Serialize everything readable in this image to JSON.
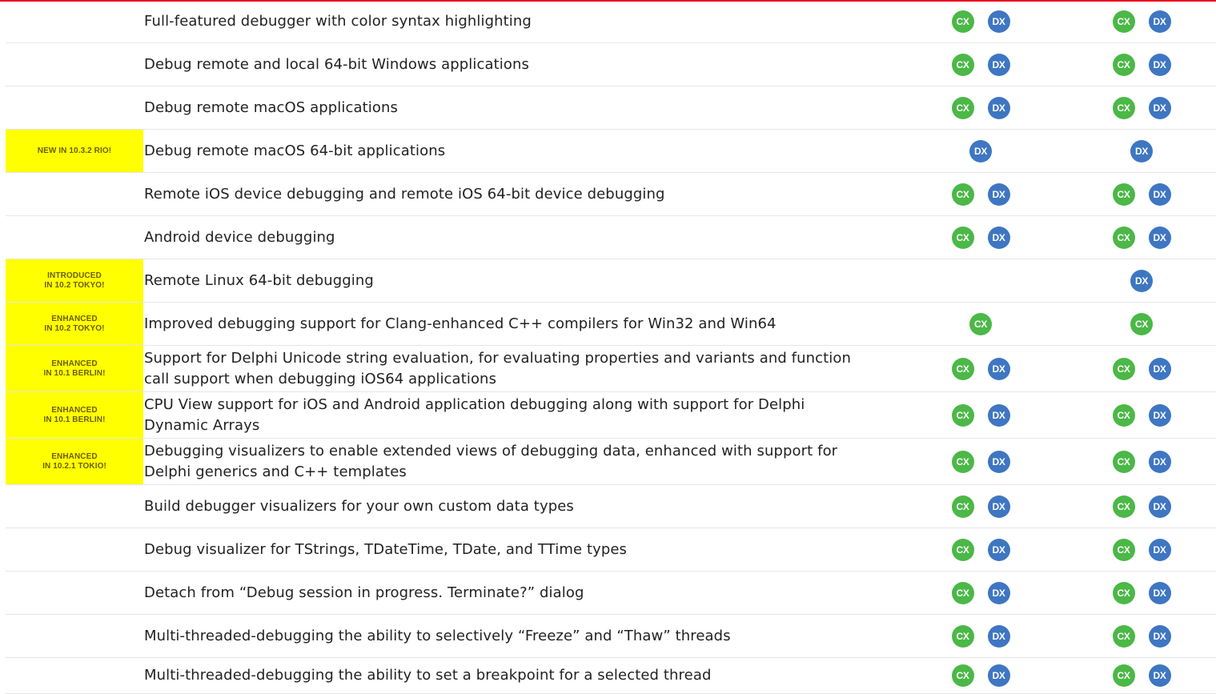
{
  "colors": {
    "cx": "#4bb847",
    "dx": "#3e76c2",
    "badge_bg": "#ffff00",
    "top_rule": "#e8001c"
  },
  "editions": {
    "cx": "CX",
    "dx": "DX"
  },
  "rows": [
    {
      "feature": "Full-featured debugger with color syntax highlighting",
      "badge": [],
      "col1": [
        "cx",
        "dx"
      ],
      "col2": [
        "cx",
        "dx"
      ]
    },
    {
      "feature": "Debug remote and local 64-bit Windows applications",
      "badge": [],
      "col1": [
        "cx",
        "dx"
      ],
      "col2": [
        "cx",
        "dx"
      ]
    },
    {
      "feature": "Debug remote macOS applications",
      "badge": [],
      "col1": [
        "cx",
        "dx"
      ],
      "col2": [
        "cx",
        "dx"
      ]
    },
    {
      "feature": "Debug remote macOS 64-bit applications",
      "badge": [
        "NEW IN 10.3.2 RIO!"
      ],
      "col1": [
        "dx"
      ],
      "col2": [
        "dx"
      ]
    },
    {
      "feature": "Remote iOS device debugging and remote iOS 64-bit device debugging",
      "badge": [],
      "col1": [
        "cx",
        "dx"
      ],
      "col2": [
        "cx",
        "dx"
      ]
    },
    {
      "feature": "Android device debugging",
      "badge": [],
      "col1": [
        "cx",
        "dx"
      ],
      "col2": [
        "cx",
        "dx"
      ]
    },
    {
      "feature": "Remote Linux 64-bit debugging",
      "badge": [
        "INTRODUCED",
        "IN 10.2 TOKYO!"
      ],
      "col1": [],
      "col2": [
        "dx"
      ]
    },
    {
      "feature": "Improved debugging support for Clang-enhanced C++ compilers for Win32 and Win64",
      "badge": [
        "ENHANCED",
        "IN 10.2 TOKYO!"
      ],
      "col1": [
        "cx"
      ],
      "col2": [
        "cx"
      ]
    },
    {
      "feature": "Support for Delphi Unicode string evaluation, for evaluating properties and variants and function call support when debugging iOS64 applications",
      "badge": [
        "ENHANCED",
        "IN 10.1 BERLIN!"
      ],
      "col1": [
        "cx",
        "dx"
      ],
      "col2": [
        "cx",
        "dx"
      ]
    },
    {
      "feature": "CPU View support for iOS and Android application debugging along with support for Delphi Dynamic Arrays",
      "badge": [
        "ENHANCED",
        "IN 10.1 BERLIN!"
      ],
      "col1": [
        "cx",
        "dx"
      ],
      "col2": [
        "cx",
        "dx"
      ]
    },
    {
      "feature": "Debugging visualizers to enable extended views of debugging data, enhanced with support for Delphi generics and C++ templates",
      "badge": [
        "ENHANCED",
        "IN 10.2.1 TOKIO!"
      ],
      "col1": [
        "cx",
        "dx"
      ],
      "col2": [
        "cx",
        "dx"
      ]
    },
    {
      "feature": "Build debugger visualizers for your own custom data types",
      "badge": [],
      "col1": [
        "cx",
        "dx"
      ],
      "col2": [
        "cx",
        "dx"
      ]
    },
    {
      "feature": "Debug visualizer for TStrings, TDateTime, TDate, and TTime types",
      "badge": [],
      "col1": [
        "cx",
        "dx"
      ],
      "col2": [
        "cx",
        "dx"
      ]
    },
    {
      "feature": "Detach from “Debug session in progress. Terminate?” dialog",
      "badge": [],
      "col1": [
        "cx",
        "dx"
      ],
      "col2": [
        "cx",
        "dx"
      ]
    },
    {
      "feature": "Multi-threaded-debugging the ability to selectively “Freeze” and “Thaw” threads",
      "badge": [],
      "col1": [
        "cx",
        "dx"
      ],
      "col2": [
        "cx",
        "dx"
      ]
    },
    {
      "feature": "Multi-threaded-debugging the ability to set a breakpoint for a selected thread",
      "badge": [],
      "col1": [
        "cx",
        "dx"
      ],
      "col2": [
        "cx",
        "dx"
      ]
    }
  ]
}
